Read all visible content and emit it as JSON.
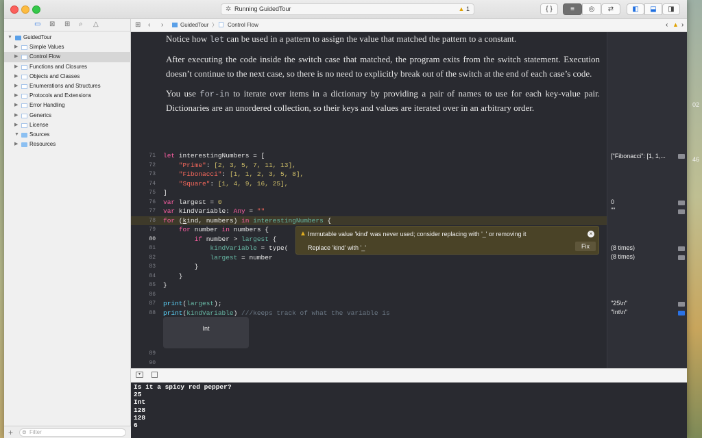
{
  "toolbar": {
    "activity_text": "Running GuidedTour",
    "warning_count": "1",
    "braces_label": "{ }"
  },
  "navigator": {
    "items": [
      {
        "label": "GuidedTour",
        "kind": "project",
        "depth": 0,
        "expanded": true
      },
      {
        "label": "Simple Values",
        "kind": "page",
        "depth": 1
      },
      {
        "label": "Control Flow",
        "kind": "page",
        "depth": 1,
        "selected": true
      },
      {
        "label": "Functions and Closures",
        "kind": "page",
        "depth": 1
      },
      {
        "label": "Objects and Classes",
        "kind": "page",
        "depth": 1
      },
      {
        "label": "Enumerations and Structures",
        "kind": "page",
        "depth": 1
      },
      {
        "label": "Protocols and Extensions",
        "kind": "page",
        "depth": 1
      },
      {
        "label": "Error Handling",
        "kind": "page",
        "depth": 1
      },
      {
        "label": "Generics",
        "kind": "page",
        "depth": 1
      },
      {
        "label": "License",
        "kind": "page",
        "depth": 1
      },
      {
        "label": "Sources",
        "kind": "folder",
        "depth": 1,
        "expanded": true
      },
      {
        "label": "Resources",
        "kind": "folder",
        "depth": 1
      }
    ],
    "filter_placeholder": "Filter"
  },
  "jumpbar": {
    "crumb1": "GuidedTour",
    "crumb2": "Control Flow"
  },
  "prose": {
    "p1_pre": "Notice how ",
    "p1_code": "let",
    "p1_post": " can be used in a pattern to assign the value that matched the pattern to a constant.",
    "p2": "After executing the code inside the switch case that matched, the program exits from the switch statement. Execution doesn’t continue to the next case, so there is no need to explicitly break out of the switch at the end of each case’s code.",
    "p3_pre": "You use ",
    "p3_code": "for-in",
    "p3_post": " to iterate over items in a dictionary by providing a pair of names to use for each key-value pair. Dictionaries are an unordered collection, so their keys and values are iterated over in an arbitrary order."
  },
  "code": {
    "line_numbers": [
      "71",
      "72",
      "73",
      "74",
      "75",
      "76",
      "77",
      "78",
      "79",
      "80",
      "81",
      "82",
      "83",
      "84",
      "85",
      "86",
      "87",
      "88",
      "89",
      "90"
    ],
    "l72_key": "\"Prime\"",
    "l72_vals": "[2, 3, 5, 7, 11, 13],",
    "l73_key": "\"Fibonacci\"",
    "l73_vals": "[1, 1, 2, 3, 5, 8],",
    "l74_key": "\"Square\"",
    "l74_vals": "[1, 4, 9, 16, 25],",
    "l88_comment": "///keeps track of what the variable is"
  },
  "warning": {
    "message": "Immutable value 'kind' was never used; consider replacing with '_' or removing it",
    "fix_description": "Replace 'kind' with '_'",
    "fix_button": "Fix"
  },
  "inline_result": "Int",
  "results": {
    "r71": "[\"Fibonacci\": [1, 1,...",
    "r76": "0",
    "r77": "\"\"",
    "r81": "(8 times)",
    "r82": "(8 times)",
    "r87": "\"25\\n\"",
    "r88": "\"Int\\n\""
  },
  "console": {
    "lines": [
      "Is it a spicy red pepper?",
      "25",
      "Int",
      "128",
      "128",
      "6"
    ]
  },
  "desktop": {
    "label1": "02",
    "label2": "46"
  }
}
